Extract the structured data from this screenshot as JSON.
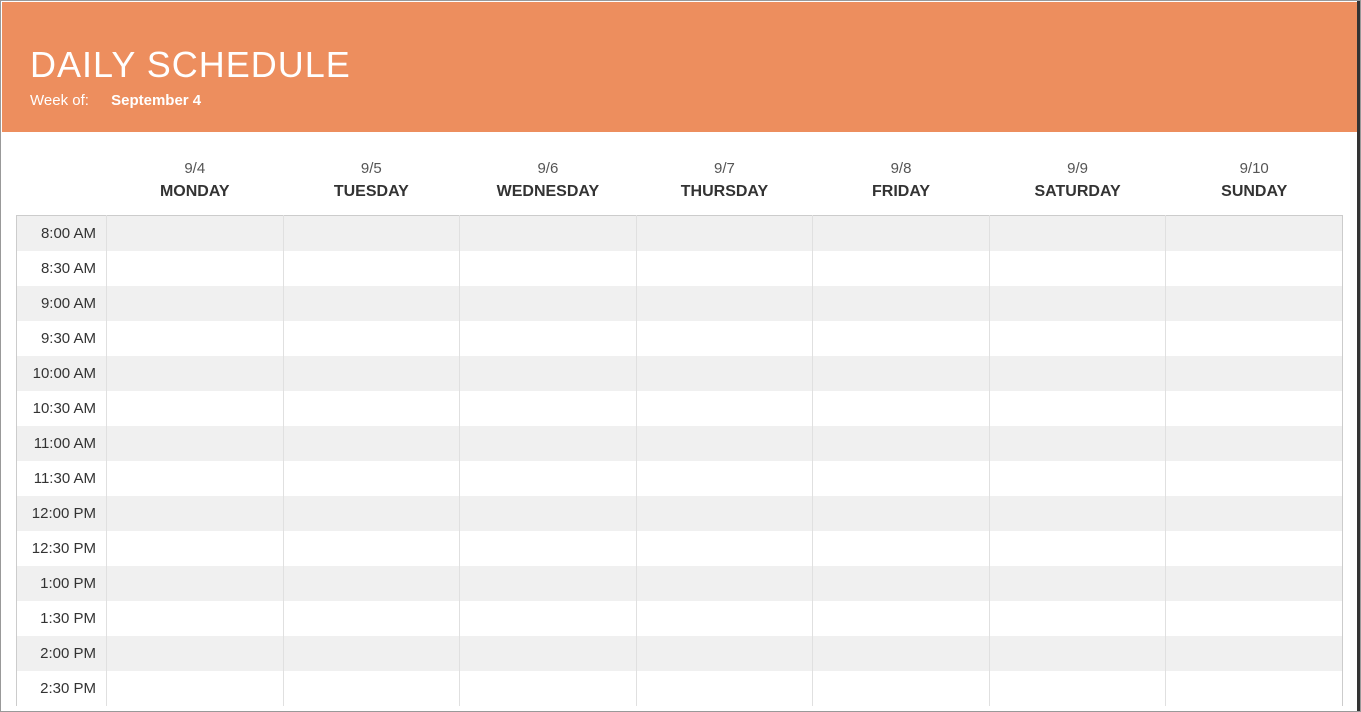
{
  "header": {
    "title": "DAILY SCHEDULE",
    "week_label": "Week of:",
    "week_value": "September 4"
  },
  "columns": [
    {
      "date": "9/4",
      "day": "MONDAY"
    },
    {
      "date": "9/5",
      "day": "TUESDAY"
    },
    {
      "date": "9/6",
      "day": "WEDNESDAY"
    },
    {
      "date": "9/7",
      "day": "THURSDAY"
    },
    {
      "date": "9/8",
      "day": "FRIDAY"
    },
    {
      "date": "9/9",
      "day": "SATURDAY"
    },
    {
      "date": "9/10",
      "day": "SUNDAY"
    }
  ],
  "times": [
    "8:00 AM",
    "8:30 AM",
    "9:00 AM",
    "9:30 AM",
    "10:00 AM",
    "10:30 AM",
    "11:00 AM",
    "11:30 AM",
    "12:00 PM",
    "12:30 PM",
    "1:00 PM",
    "1:30 PM",
    "2:00 PM",
    "2:30 PM"
  ]
}
